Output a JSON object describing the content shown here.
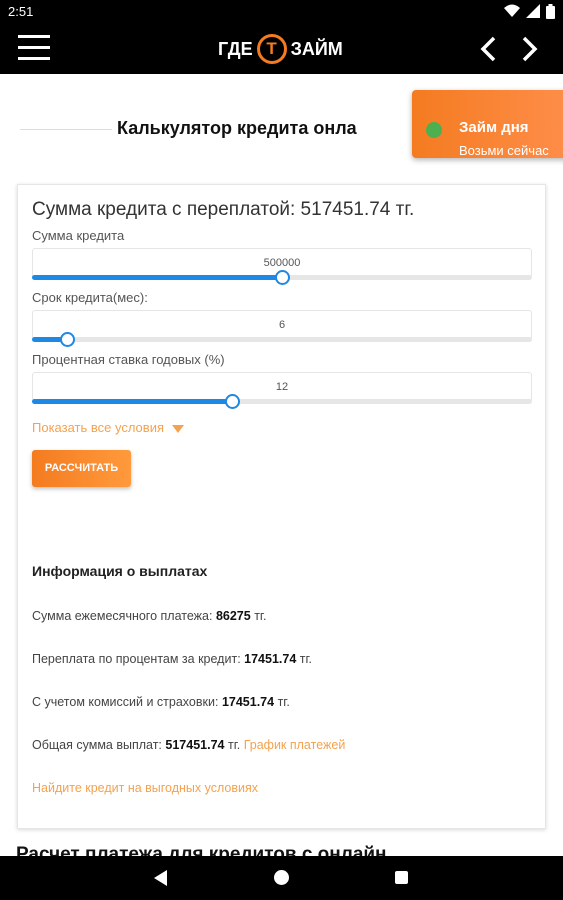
{
  "statusbar": {
    "time": "2:51"
  },
  "appbar": {
    "logo_left": "ГДЕ",
    "logo_mid": "Т",
    "logo_right": "ЗАЙМ"
  },
  "page": {
    "title": "Калькулятор кредита онла"
  },
  "toast": {
    "title": "Займ дня",
    "subtitle": "Возьми сейчас"
  },
  "calculator": {
    "heading": "Сумма кредита с переплатой: 517451.74 тг.",
    "fields": [
      {
        "label": "Сумма кредита",
        "value": "500000",
        "fill_fraction": 0.5
      },
      {
        "label": "Срок кредита(мес):",
        "value": "6",
        "fill_fraction": 0.07
      },
      {
        "label": "Процентная ставка годовых (%)",
        "value": "12",
        "fill_fraction": 0.4
      }
    ],
    "show_all": "Показать все условия",
    "calc_button": "РАССЧИТАТЬ"
  },
  "payments": {
    "title": "Информация о выплатах",
    "monthly_label": "Сумма ежемесячного платежа:",
    "monthly_value": "86275",
    "overpay_label": "Переплата по процентам за кредит:",
    "overpay_value": "17451.74",
    "fees_label": "С учетом комиссий и страховки:",
    "fees_value": "17451.74",
    "total_label": "Общая сумма выплат:",
    "total_value": "517451.74",
    "currency": "тг.",
    "schedule_link": "График платежей",
    "find_link": "Найдите кредит на выгодных условиях"
  },
  "bottom": {
    "heading": "Расчет платежа для кредитов с онлайн"
  },
  "colors": {
    "accent": "#f47b20",
    "slider": "#1e88e5",
    "link": "#f4a24f",
    "toast_dot": "#4caf50"
  },
  "icons": [
    "wifi-icon",
    "signal-icon",
    "battery-icon",
    "menu-icon",
    "chevron-left-icon",
    "chevron-right-icon",
    "dropdown-triangle-icon",
    "nav-back-icon",
    "nav-home-icon",
    "nav-recent-icon"
  ]
}
